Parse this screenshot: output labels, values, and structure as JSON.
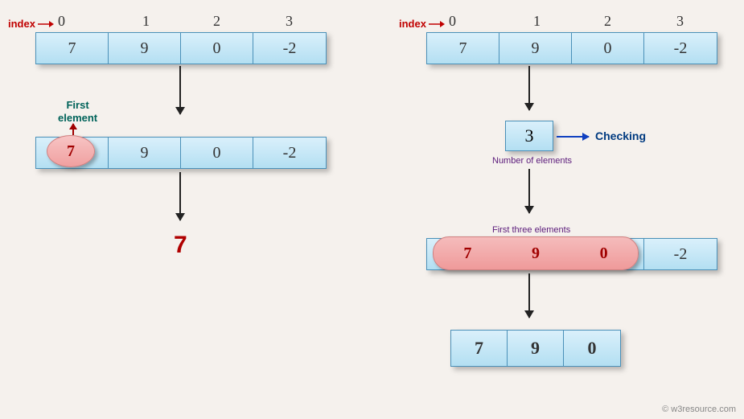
{
  "left": {
    "index_label": "index",
    "indices": [
      "0",
      "1",
      "2",
      "3"
    ],
    "array": [
      "7",
      "9",
      "0",
      "-2"
    ],
    "first_element_label": "First\nelement",
    "highlight_value": "7",
    "result": "7"
  },
  "right": {
    "index_label": "index",
    "indices": [
      "0",
      "1",
      "2",
      "3"
    ],
    "array": [
      "7",
      "9",
      "0",
      "-2"
    ],
    "check_value": "3",
    "checking_label": "Checking",
    "num_elements_label": "Number of elements",
    "first_three_label": "First three elements",
    "highlight_values": [
      "7",
      "9",
      "0"
    ],
    "result_array": [
      "7",
      "9",
      "0"
    ]
  },
  "footer": "© w3resource.com",
  "chart_data": {
    "type": "table",
    "description": "Diagram showing array first-element extraction on the left and first-n-elements extraction on the right.",
    "left_flow": {
      "input_array": [
        7,
        9,
        0,
        -2
      ],
      "operation": "take first element",
      "output": 7
    },
    "right_flow": {
      "input_array": [
        7,
        9,
        0,
        -2
      ],
      "n": 3,
      "operation": "take first n elements",
      "output": [
        7,
        9,
        0
      ]
    }
  }
}
